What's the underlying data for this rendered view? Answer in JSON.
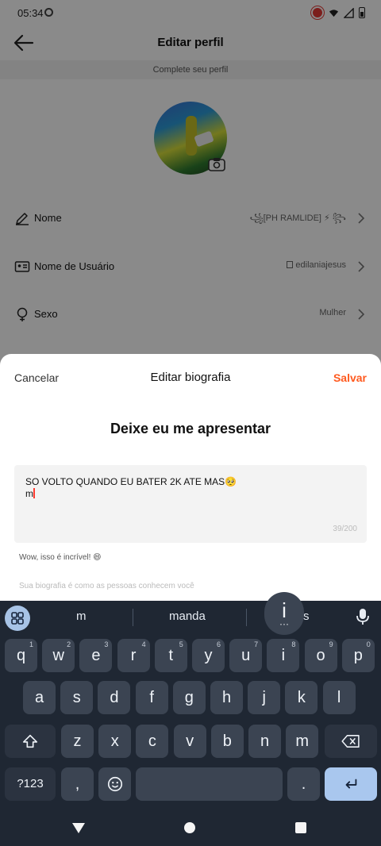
{
  "status": {
    "time": "05:34"
  },
  "header": {
    "title": "Editar perfil",
    "subtitle": "Complete seu perfil"
  },
  "profile_rows": [
    {
      "label": "Nome",
      "value": "꧁[PH RAMLIDE] ⚡ ꧂"
    },
    {
      "label": "Nome de Usuário",
      "value": "edilaniajesus"
    },
    {
      "label": "Sexo",
      "value": "Mulher"
    }
  ],
  "sheet": {
    "cancel_label": "Cancelar",
    "title": "Editar biografia",
    "save_label": "Salvar",
    "heading": "Deixe eu me apresentar",
    "bio_line1": "SO VOLTO QUANDO EU BATER 2K ATE MAS🥺",
    "bio_line2": "m",
    "char_count": "39/200",
    "hint": "Wow, isso é incrível! 😄",
    "placeholder_hint": "Sua biografia é como as pessoas conhecem você",
    "accent_color": "#ff5a1f"
  },
  "keyboard": {
    "suggestions": [
      "m",
      "manda",
      "s"
    ],
    "popup_char": "i",
    "row1": [
      {
        "k": "q",
        "n": "1"
      },
      {
        "k": "w",
        "n": "2"
      },
      {
        "k": "e",
        "n": "3"
      },
      {
        "k": "r",
        "n": "4"
      },
      {
        "k": "t",
        "n": "5"
      },
      {
        "k": "y",
        "n": "6"
      },
      {
        "k": "u",
        "n": "7"
      },
      {
        "k": "i",
        "n": "8"
      },
      {
        "k": "o",
        "n": "9"
      },
      {
        "k": "p",
        "n": "0"
      }
    ],
    "row2": [
      "a",
      "s",
      "d",
      "f",
      "g",
      "h",
      "j",
      "k",
      "l"
    ],
    "row3": [
      "z",
      "x",
      "c",
      "v",
      "b",
      "n",
      "m"
    ],
    "symbols_label": "?123",
    "comma_label": ",",
    "period_label": "."
  }
}
